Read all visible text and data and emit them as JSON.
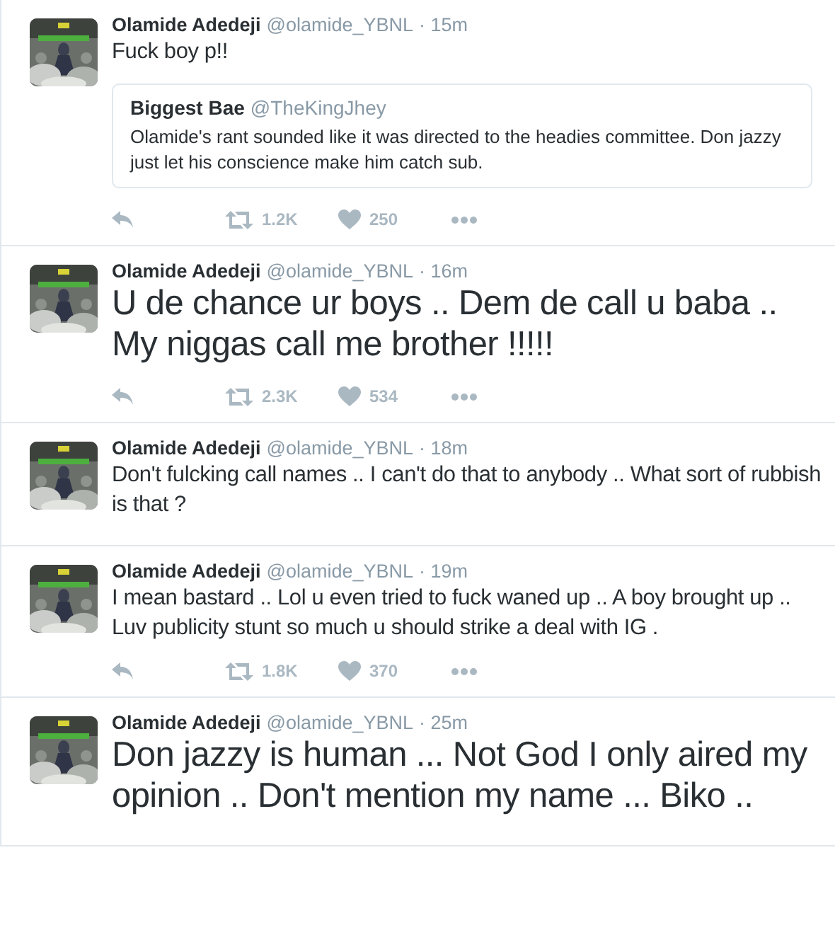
{
  "tweets": [
    {
      "name": "Olamide Adedeji",
      "handle": "@olamide_YBNL",
      "time": "· 15m",
      "kind": "normal",
      "text": "Fuck boy p!!",
      "quote": {
        "name": "Biggest Bae",
        "handle": "@TheKingJhey",
        "text": "Olamide's rant sounded like it was directed to the headies committee. Don jazzy just let his conscience make him catch sub."
      },
      "actions": {
        "retweets": "1.2K",
        "likes": "250"
      }
    },
    {
      "name": "Olamide Adedeji",
      "handle": "@olamide_YBNL",
      "time": "· 16m",
      "kind": "large",
      "text": "U de chance ur boys .. Dem de call u baba .. My niggas call me brother !!!!!",
      "actions": {
        "retweets": "2.3K",
        "likes": "534"
      }
    },
    {
      "name": "Olamide Adedeji",
      "handle": "@olamide_YBNL",
      "time": "· 18m",
      "kind": "normal",
      "text": "Don't fulcking call names .. I can't do that to anybody .. What sort of rubbish is that ?"
    },
    {
      "name": "Olamide Adedeji",
      "handle": "@olamide_YBNL",
      "time": "· 19m",
      "kind": "normal",
      "text": "I mean bastard .. Lol u even tried to fuck waned up .. A boy brought up .. Luv publicity stunt so much u should strike a deal with IG .",
      "actions": {
        "retweets": "1.8K",
        "likes": "370"
      }
    },
    {
      "name": "Olamide Adedeji",
      "handle": "@olamide_YBNL",
      "time": "· 25m",
      "kind": "large",
      "text": "Don jazzy is human ... Not God I only aired my opinion .. Don't mention my name ... Biko .."
    }
  ]
}
